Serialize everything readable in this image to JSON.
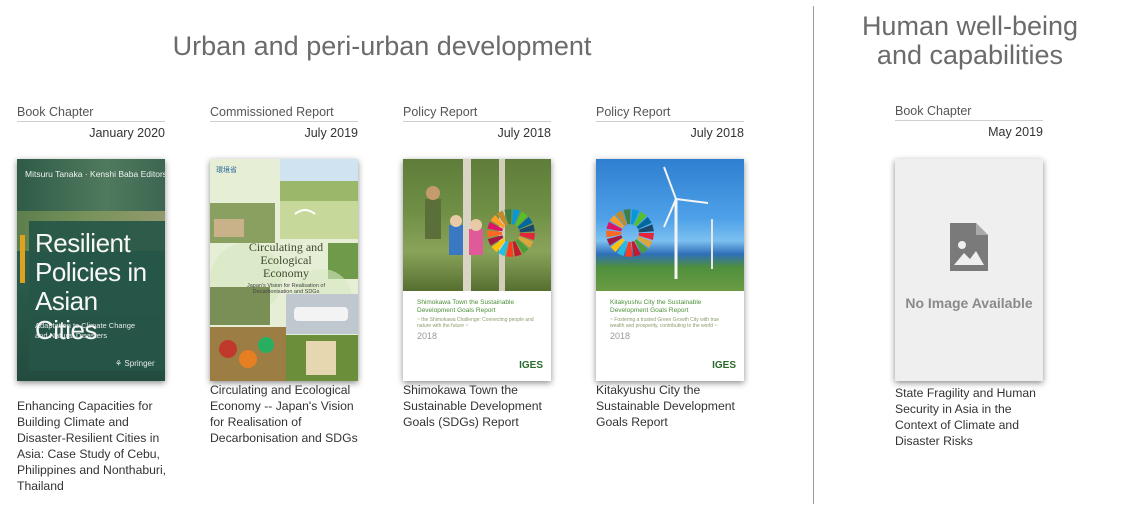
{
  "sections": {
    "urban": {
      "title": "Urban and peri-urban development"
    },
    "human": {
      "title": "Human well-being and capabilities"
    }
  },
  "cards": [
    {
      "type": "Book Chapter",
      "date": "January 2020",
      "caption": "Enhancing Capacities for Building Climate and Disaster-Resilient Cities in Asia: Case Study of Cebu, Philippines and Nonthaburi, Thailand",
      "cover": {
        "authors": "Mitsuru Tanaka · Kenshi Baba  Editors",
        "title_lines": [
          "Resilient",
          "Policies in",
          "Asian Cities"
        ],
        "subtitle": "Adaptation to Climate Change and Natural Disasters",
        "publisher": "Springer"
      }
    },
    {
      "type": "Commissioned Report",
      "date": "July 2019",
      "caption": "Circulating and Ecological Economy -- Japan's Vision for Realisation of Decarbonisation and SDGs",
      "cover": {
        "ministry": "環境省",
        "title": "Circulating and Ecological Economy",
        "subtitle": "Japan's Vision for Realisation of Decarbonisation and SDGs"
      }
    },
    {
      "type": "Policy Report",
      "date": "July 2018",
      "caption": "Shimokawa Town the Sustainable Development Goals (SDGs) Report",
      "cover": {
        "title": "Shimokawa Town the Sustainable Development Goals Report",
        "tagline": "~ the Shimokawa Challenge: Connecting people and nature with the future ~",
        "year": "2018",
        "logo": "IGES"
      }
    },
    {
      "type": "Policy Report",
      "date": "July 2018",
      "caption": "Kitakyushu City the Sustainable Development Goals Report",
      "cover": {
        "title": "Kitakyushu City the Sustainable Development Goals Report",
        "tagline": "~ Fostering a trusted Green Growth City with true wealth and prosperity, contributing to the world ~",
        "year": "2018",
        "logo": "IGES"
      }
    },
    {
      "type": "Book Chapter",
      "date": "May 2019",
      "caption": "State Fragility and Human Security in Asia in the Context of Climate and Disaster Risks",
      "cover": {
        "placeholder": "No Image Available"
      }
    }
  ],
  "colors": {
    "section_title": "#6b6b6b",
    "divider": "#9a9a9a",
    "sdg_wheel": [
      "#e5243b",
      "#dda63a",
      "#4c9f38",
      "#c5192d",
      "#ff3a21",
      "#26bde2",
      "#fcc30b",
      "#a21942",
      "#fd6925",
      "#dd1367",
      "#fd9d24",
      "#bf8b2e",
      "#3f7e44",
      "#0a97d9",
      "#56c02b",
      "#00689d",
      "#19486a"
    ]
  }
}
